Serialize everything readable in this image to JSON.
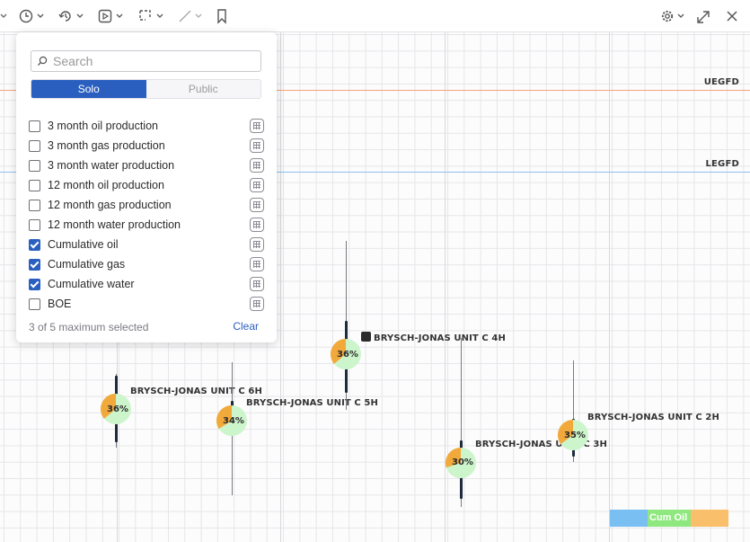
{
  "toolbar": {
    "left_tools": [
      "clock-chevron",
      "refresh-chevron",
      "play-box-chevron",
      "lasso-chevron",
      "line-chevron",
      "bookmark"
    ],
    "right_tools": [
      "gear-chevron",
      "expand",
      "close"
    ]
  },
  "panel": {
    "search_placeholder": "Search",
    "tabs": {
      "solo": "Solo",
      "public": "Public"
    },
    "items": [
      {
        "label": "3 month oil production",
        "checked": false
      },
      {
        "label": "3 month gas production",
        "checked": false
      },
      {
        "label": "3 month water production",
        "checked": false
      },
      {
        "label": "12 month oil production",
        "checked": false
      },
      {
        "label": "12 month gas production",
        "checked": false
      },
      {
        "label": "12 month water production",
        "checked": false
      },
      {
        "label": "Cumulative oil",
        "checked": true
      },
      {
        "label": "Cumulative gas",
        "checked": true
      },
      {
        "label": "Cumulative water",
        "checked": true
      },
      {
        "label": "BOE",
        "checked": false
      }
    ],
    "selected_text": "3 of 5 maximum selected",
    "clear_label": "Clear"
  },
  "horizons": {
    "upper": {
      "label": "UEGFD",
      "color": "#f4a37a"
    },
    "lower": {
      "label": "LEGFD",
      "color": "#8cc1ee"
    }
  },
  "wells": [
    {
      "name": "BRYSCH-JONAS UNIT C 6H",
      "pct": "36%",
      "value": 36,
      "phone": false
    },
    {
      "name": "BRYSCH-JONAS UNIT C 5H",
      "pct": "34%",
      "value": 34,
      "phone": false
    },
    {
      "name": "BRYSCH-JONAS UNIT C 4H",
      "pct": "36%",
      "value": 36,
      "phone": true
    },
    {
      "name": "BRYSCH-JONAS UNIT C 3H",
      "pct": "30%",
      "value": 30,
      "phone": false
    },
    {
      "name": "BRYSCH-JONAS UNIT C 2H",
      "pct": "35%",
      "value": 35,
      "phone": false
    }
  ],
  "colors": {
    "accent": "#2a5fbf",
    "pie_main": "#f2a93b",
    "pie_rest": "#cdf5cc"
  },
  "legend": {
    "label": "Cum Oil",
    "colors": [
      "#79bff2",
      "#8fe87f",
      "#f9bf6a"
    ]
  }
}
